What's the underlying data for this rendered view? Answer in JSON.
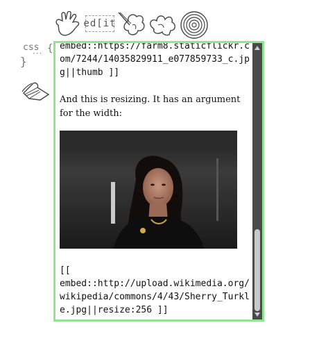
{
  "toolbar": {
    "hand_icon": "hand-icon",
    "edit_label": "ed[it",
    "pen_icon": "pen-icon",
    "cloud_icon": "cloud-icon",
    "spiral_icon": "spiral-icon"
  },
  "sidebar": {
    "css_label": "css",
    "brace": "{",
    "dots": "···",
    "squiggle": "}",
    "book_icon": "book-icon"
  },
  "editor": {
    "code_top": "embed::https://farm8.staticflickr.com/7244/14035829911_e077859733_c.jpg||thumb ]]",
    "prose": "And this is resizing. It has an argument for the width:",
    "photo_alt": "Sherry Turkle",
    "code_bottom": "[[\nembed::http://upload.wikimedia.org/wikipedia/commons/4/43/Sherry_Turkle.jpg||resize:256 ]]"
  },
  "colors": {
    "editor_border": "#8ee68e",
    "scrollbar": "#4a4a4a",
    "scroll_thumb": "#c8c8c8"
  }
}
